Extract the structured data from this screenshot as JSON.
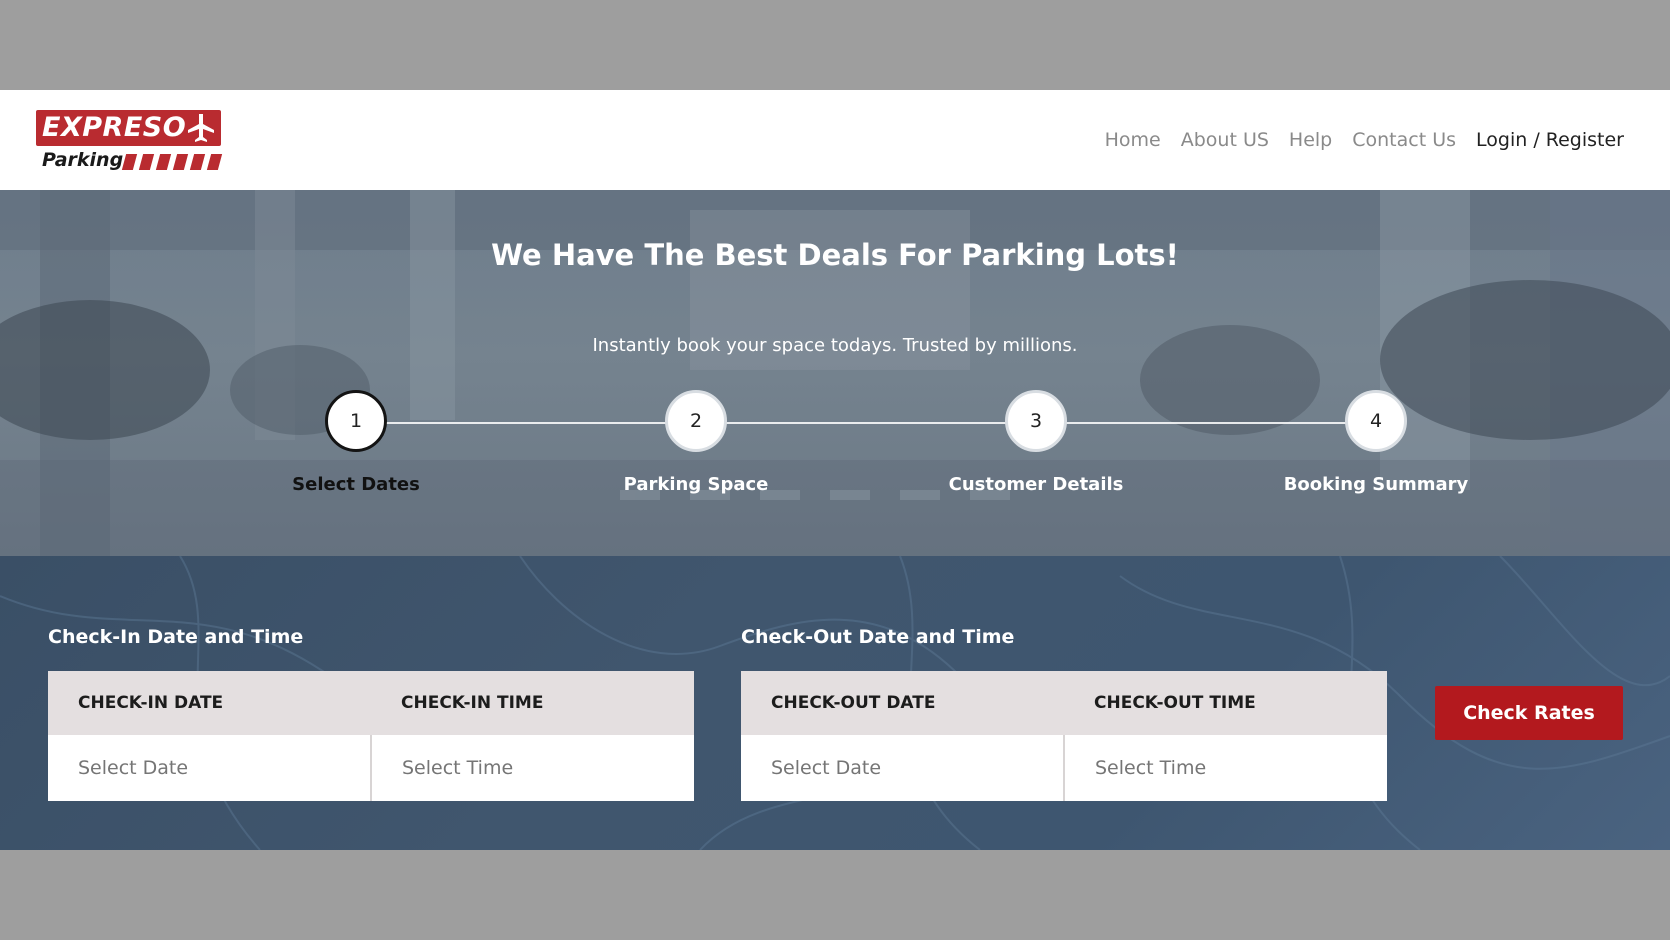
{
  "brand": {
    "name_top": "EXPRESO",
    "name_bottom": "Parking",
    "color": "#b92b30"
  },
  "nav": {
    "items": [
      "Home",
      "About US",
      "Help",
      "Contact Us"
    ],
    "login_label": "Login / Register"
  },
  "hero": {
    "title": "We Have The Best Deals For Parking Lots!",
    "subtitle": "Instantly book your space todays. Trusted by millions."
  },
  "steps": [
    {
      "number": "1",
      "label": "Select Dates",
      "active": true
    },
    {
      "number": "2",
      "label": "Parking Space",
      "active": false
    },
    {
      "number": "3",
      "label": "Customer Details",
      "active": false
    },
    {
      "number": "4",
      "label": "Booking Summary",
      "active": false
    }
  ],
  "booking": {
    "checkin": {
      "title": "Check-In Date and Time",
      "date_label": "CHECK-IN DATE",
      "time_label": "CHECK-IN TIME",
      "date_placeholder": "Select Date",
      "time_placeholder": "Select Time"
    },
    "checkout": {
      "title": "Check-Out Date and Time",
      "date_label": "CHECK-OUT DATE",
      "time_label": "CHECK-OUT TIME",
      "date_placeholder": "Select Date",
      "time_placeholder": "Select Time"
    },
    "button_label": "Check Rates",
    "button_color": "#b3191e"
  },
  "icons": {
    "logo_plane": "airplane-icon"
  }
}
